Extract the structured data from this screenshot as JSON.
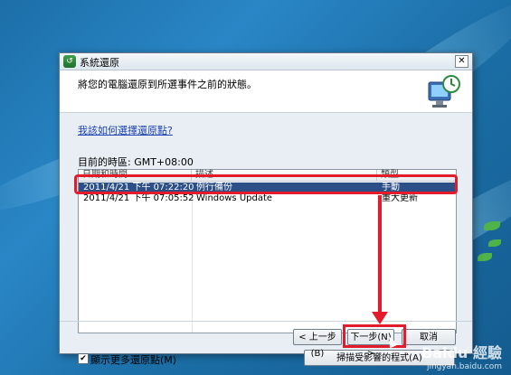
{
  "dialog": {
    "title": "系統還原",
    "close_glyph": "✕",
    "header_text": "將您的電腦還原到所選事件之前的狀態。",
    "help_link": "我該如何選擇還原點?",
    "timezone_label": "目前的時區: GMT+08:00",
    "columns": [
      "日期和時間",
      "描述",
      "類型"
    ],
    "rows": [
      {
        "datetime": "2011/4/21 下午 07:22:20",
        "description": "例行備份",
        "type": "手動",
        "selected": true
      },
      {
        "datetime": "2011/4/21 下午 07:05:52",
        "description": "Windows Update",
        "type": "重大更新",
        "selected": false
      }
    ],
    "show_more_label": "顯示更多還原點(M)",
    "show_more_checked": true,
    "scan_button": "掃描受影響的程式(A)",
    "back_button": "< 上一步(B)",
    "next_button": "下一步(N) >",
    "cancel_button": "取消"
  },
  "watermark": {
    "logo": "Baidu 經驗",
    "url": "jingyan.baidu.com"
  },
  "colors": {
    "highlight_red": "#e21c2a",
    "selection_blue": "#2b4f86",
    "desktop_blue": "#1c6fa8"
  }
}
